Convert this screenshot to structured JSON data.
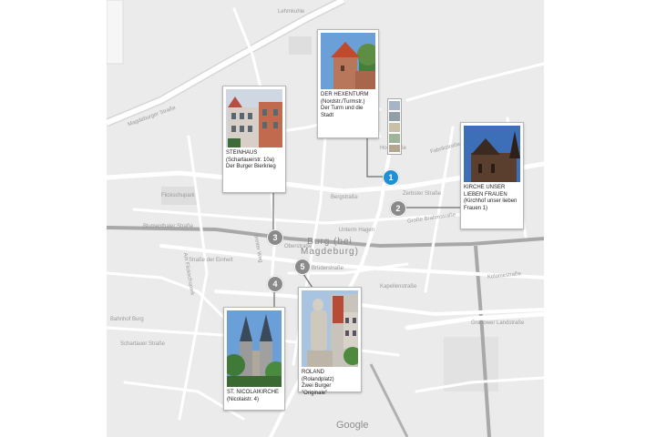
{
  "map": {
    "city_label_line1": "Burg (bei",
    "city_label_line2": "Magdeburg)",
    "attribution": "Google",
    "streets": [
      {
        "id": "s1",
        "text": "Lehmkuhle"
      },
      {
        "id": "s2",
        "text": "Magdeburger Straße"
      },
      {
        "id": "s3",
        "text": "Straße der Einheit"
      },
      {
        "id": "s4",
        "text": "Brüderstraße"
      },
      {
        "id": "s5",
        "text": "Bergstraße"
      },
      {
        "id": "s6",
        "text": "Holzstraße"
      },
      {
        "id": "s7",
        "text": "Kapellenstraße"
      },
      {
        "id": "s8",
        "text": "Große Brahmstraße"
      },
      {
        "id": "s9",
        "text": "Zerbster Straße"
      },
      {
        "id": "s10",
        "text": "Flickschupark"
      },
      {
        "id": "s11",
        "text": "Bahnhof Burg"
      },
      {
        "id": "s12",
        "text": "Grabower Landstraße"
      },
      {
        "id": "s13",
        "text": "Koloniestraße"
      },
      {
        "id": "s14",
        "text": "Blumenthaler Straße"
      },
      {
        "id": "s15",
        "text": "Am Flickschupark"
      },
      {
        "id": "s16",
        "text": "Schartauer Straße"
      },
      {
        "id": "s17",
        "text": "Breiter Weg"
      },
      {
        "id": "s18",
        "text": "Oberstraße"
      },
      {
        "id": "s19",
        "text": "Unterm Hagen"
      },
      {
        "id": "s20",
        "text": "Fabrikstraße"
      }
    ]
  },
  "places": [
    {
      "number": "1",
      "title": "DER HEXENTURM",
      "line2": "(Nordstr./Turmstr.)",
      "line3": "Der Turm und die Stadt"
    },
    {
      "number": "2",
      "title": "KIRCHE UNSER LIEBEN FRAUEN",
      "line2": "(Kirchhof unser lieben Frauen 1)",
      "line3": ""
    },
    {
      "number": "3",
      "title": "STEINHAUS",
      "line2": "(Schartauerstr. 10a)",
      "line3": "Der Burger Bierkrieg"
    },
    {
      "number": "4",
      "title": "ST. NICOLAIKIRCHE",
      "line2": "(Nicolaistr. 4)",
      "line3": ""
    },
    {
      "number": "5",
      "title": "ROLAND",
      "line2": "(Rolandplatz)",
      "line3": "Zwei Burger \"Originale\""
    }
  ],
  "colors": {
    "map_bg": "#ebebeb",
    "road": "#ffffff",
    "rail": "#9e9e9e",
    "marker_grey": "#8a8a8a",
    "marker_blue": "#1e90d6"
  }
}
